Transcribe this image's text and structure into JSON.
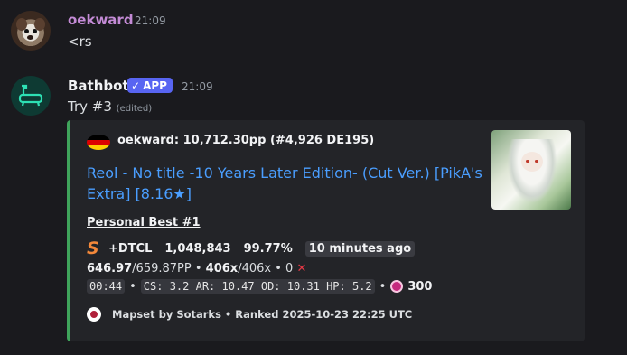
{
  "messages": [
    {
      "author": "oekward",
      "author_color": "#c48bd6",
      "time": "21:09",
      "text": "<rs"
    },
    {
      "author": "Bathbot",
      "badge": "APP",
      "badge_check": "✓",
      "time": "21:09",
      "text": "Try #3",
      "edited": "(edited)"
    }
  ],
  "embed": {
    "accent_color": "#3fa45b",
    "flag": "DE",
    "author_line": "oekward: 10,712.30pp (#4,926 DE195)",
    "title": "Reol - No title -10 Years Later Edition- (Cut Ver.) [PikA's Extra] [8.16★]",
    "field_name": "Personal Best #1",
    "grade": "S",
    "mods": "+DTCL",
    "score": "1,048,843",
    "accuracy": "99.77%",
    "ago": "10 minutes ago",
    "pp": "646.97",
    "pp_max": "/659.87PP",
    "combo_cur": "406x",
    "combo_max": "/406x",
    "misses": "0",
    "miss_mark": "✕",
    "length": "00:44",
    "stats": "CS: 3.2 AR: 10.47 OD: 10.31 HP: 5.2",
    "max_combo_icon": "osu-icon",
    "max_combo": "300",
    "footer": "Mapset by Sotarks • Ranked 2025-10-23 22:25 UTC",
    "sep": "•"
  }
}
